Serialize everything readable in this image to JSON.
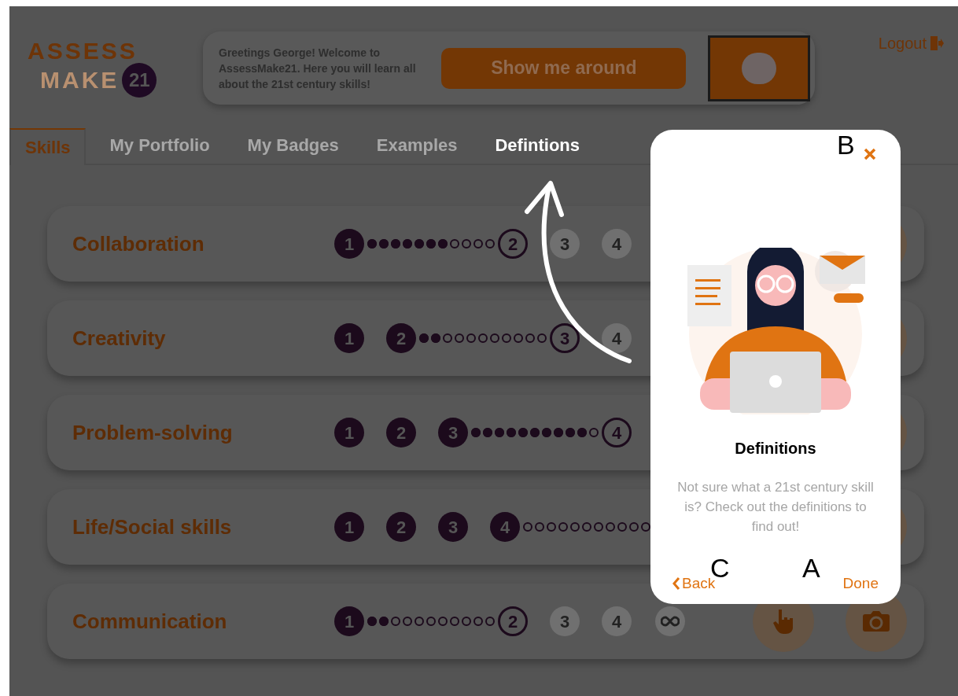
{
  "logo": {
    "line_1": "ASSESS",
    "line_2": "MAKE",
    "badge": "21"
  },
  "greeting": {
    "text": "Greetings George! Welcome to AssessMake21. Here you will learn all about the 21st century skills!",
    "button": "Show me around"
  },
  "logout": "Logout",
  "tabs": [
    {
      "label": "Skills",
      "selected": true,
      "spotlight": false
    },
    {
      "label": "My Portfolio",
      "selected": false,
      "spotlight": false
    },
    {
      "label": "My Badges",
      "selected": false,
      "spotlight": false
    },
    {
      "label": "Examples",
      "selected": false,
      "spotlight": false
    },
    {
      "label": "Defintions",
      "selected": false,
      "spotlight": true
    }
  ],
  "skills": [
    {
      "name": "Collaboration",
      "level": 0.64,
      "stages": [
        {
          "label": "1",
          "kind": "done"
        },
        {
          "label": "2",
          "kind": "current"
        },
        {
          "label": "3",
          "kind": "locked"
        },
        {
          "label": "4",
          "kind": "locked"
        }
      ]
    },
    {
      "name": "Creativity",
      "level": 0.18,
      "stages": [
        {
          "label": "1",
          "kind": "done"
        },
        {
          "label": "2",
          "kind": "done"
        },
        {
          "label": "3",
          "kind": "current"
        },
        {
          "label": "4",
          "kind": "locked"
        }
      ]
    },
    {
      "name": "Problem-solving",
      "level": 0.91,
      "stages": [
        {
          "label": "1",
          "kind": "done"
        },
        {
          "label": "2",
          "kind": "done"
        },
        {
          "label": "3",
          "kind": "done"
        },
        {
          "label": "4",
          "kind": "current"
        }
      ]
    },
    {
      "name": "Life/Social skills",
      "stages": [
        {
          "label": "1",
          "kind": "done"
        },
        {
          "label": "2",
          "kind": "done"
        },
        {
          "label": "3",
          "kind": "done"
        },
        {
          "label": "4",
          "kind": "done"
        }
      ]
    },
    {
      "name": "Communication",
      "level": 0.18,
      "stages": [
        {
          "label": "1",
          "kind": "done"
        },
        {
          "label": "2",
          "kind": "current"
        },
        {
          "label": "3",
          "kind": "locked"
        },
        {
          "label": "4",
          "kind": "locked"
        }
      ]
    }
  ],
  "popup": {
    "title": "Definitions",
    "text": "Not sure what a 21st century skill is? Check out the definitions to find out!",
    "back": "Back",
    "done": "Done"
  },
  "markers": [
    {
      "label": "B"
    },
    {
      "label": "C"
    },
    {
      "label": "A"
    }
  ]
}
